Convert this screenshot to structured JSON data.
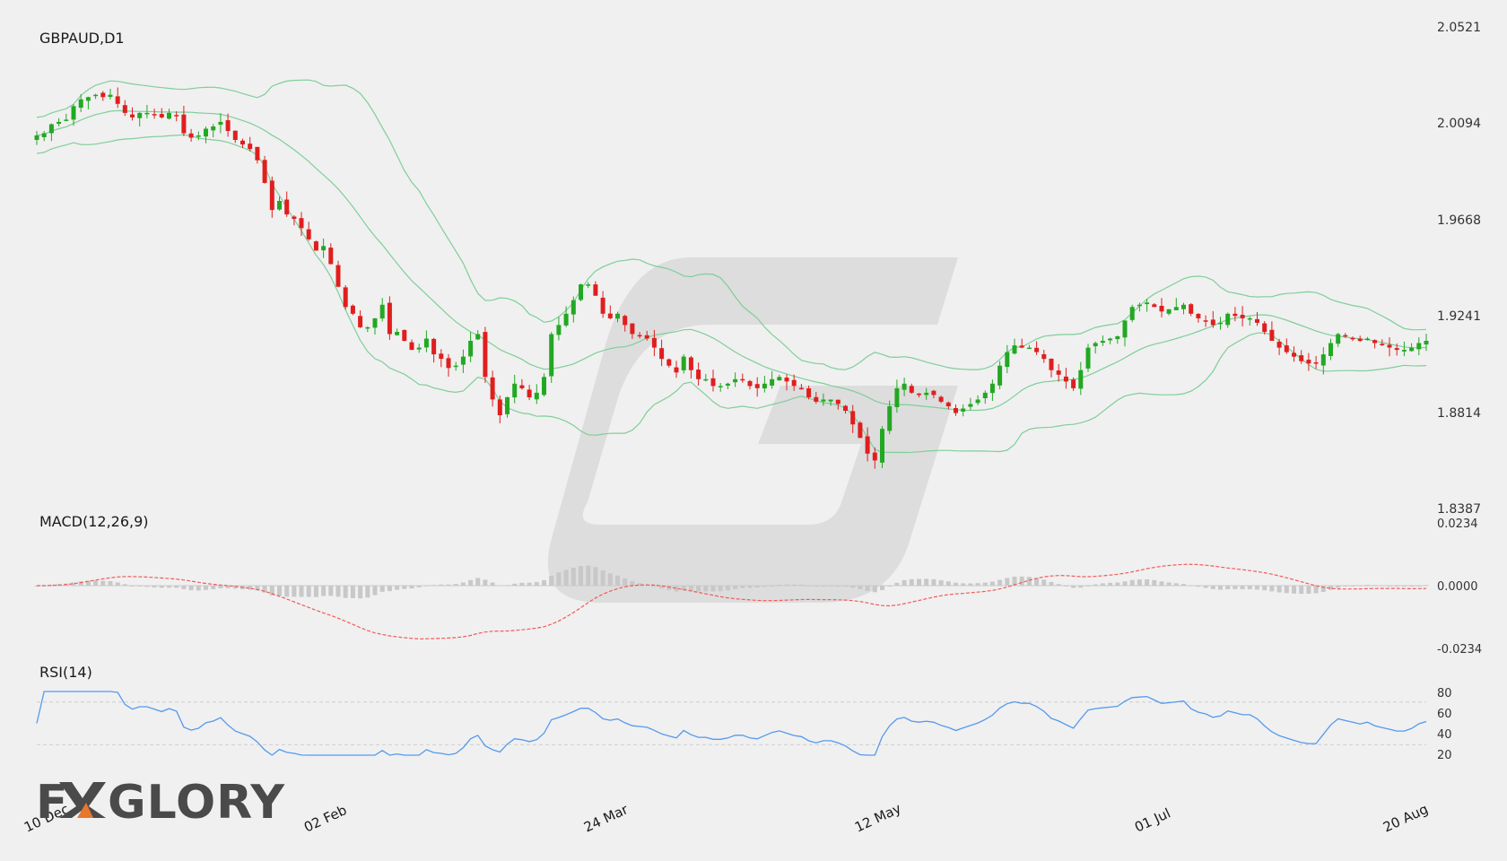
{
  "brand": {
    "logo_text_left": "F",
    "logo_text_right": "GLORY",
    "accent_color": "#e8772e",
    "text_color": "#4a4a4a"
  },
  "colors": {
    "up": "#22a822",
    "down": "#e01e1e",
    "band": "#7fce9a",
    "macd_hist": "#c8c8c8",
    "macd_signal": "#f25a5a",
    "rsi_line": "#5599ee",
    "grid": "#cccccc"
  },
  "chart_data": [
    {
      "type": "candlestick",
      "title": "GBPAUD,D1",
      "y_ticks": [
        "2.0521",
        "2.0094",
        "1.9668",
        "1.9241",
        "1.8814",
        "1.8387"
      ],
      "ylim": [
        1.8387,
        2.0521
      ],
      "x_ticks": [
        "10 Dec",
        "02 Feb",
        "24 Mar",
        "12 May",
        "01 Jul",
        "20 Aug"
      ],
      "close_series": [
        2.004,
        2.005,
        2.009,
        2.01,
        2.011,
        2.017,
        2.02,
        2.021,
        2.022,
        2.021,
        2.022,
        2.018,
        2.014,
        2.012,
        2.014,
        2.014,
        2.013,
        2.012,
        2.014,
        2.013,
        2.005,
        2.003,
        2.004,
        2.007,
        2.008,
        2.01,
        2.006,
        2.002,
        2.0,
        1.998,
        1.993,
        1.983,
        1.971,
        1.975,
        1.969,
        1.967,
        1.963,
        1.958,
        1.953,
        1.955,
        1.947,
        1.937,
        1.928,
        1.925,
        1.919,
        1.919,
        1.923,
        1.929,
        1.916,
        1.917,
        1.913,
        1.909,
        1.91,
        1.914,
        1.907,
        1.905,
        1.901,
        1.902,
        1.906,
        1.913,
        1.916,
        1.897,
        1.887,
        1.88,
        1.888,
        1.894,
        1.892,
        1.888,
        1.89,
        1.897,
        1.916,
        1.92,
        1.925,
        1.931,
        1.938,
        1.938,
        1.933,
        1.925,
        1.923,
        1.925,
        1.92,
        1.916,
        1.915,
        1.914,
        1.91,
        1.905,
        1.902,
        1.899,
        1.906,
        1.9,
        1.896,
        1.896,
        1.893,
        1.893,
        1.894,
        1.896,
        1.896,
        1.893,
        1.892,
        1.894,
        1.896,
        1.897,
        1.895,
        1.893,
        1.892,
        1.888,
        1.886,
        1.887,
        1.887,
        1.885,
        1.882,
        1.876,
        1.87,
        1.863,
        1.86,
        1.874,
        1.884,
        1.892,
        1.894,
        1.89,
        1.889,
        1.89,
        1.889,
        1.886,
        1.884,
        1.881,
        1.883,
        1.885,
        1.887,
        1.89,
        1.894,
        1.902,
        1.908,
        1.911,
        1.91,
        1.91,
        1.908,
        1.905,
        1.9,
        1.898,
        1.895,
        1.892,
        1.9,
        1.91,
        1.912,
        1.913,
        1.914,
        1.915,
        1.922,
        1.928,
        1.929,
        1.93,
        1.928,
        1.926,
        1.927,
        1.928,
        1.929,
        1.925,
        1.923,
        1.922,
        1.92,
        1.921,
        1.925,
        1.924,
        1.923,
        1.923,
        1.921,
        1.917,
        1.913,
        1.91,
        1.908,
        1.906,
        1.904,
        1.903,
        1.903,
        1.907,
        1.912,
        1.916,
        1.915,
        1.914,
        1.913,
        1.914,
        1.912,
        1.911,
        1.91,
        1.909,
        1.909,
        1.91,
        1.912,
        1.913
      ]
    },
    {
      "type": "bar+line",
      "title": "MACD(12,26,9)",
      "y_ticks": [
        "0.0234",
        "0.0000",
        "-0.0234"
      ],
      "ylim": [
        -0.0234,
        0.0234
      ]
    },
    {
      "type": "line",
      "title": "RSI(14)",
      "y_ticks": [
        "80",
        "60",
        "40",
        "20"
      ],
      "ylim": [
        20,
        80
      ],
      "guide_levels": [
        70,
        30
      ]
    }
  ]
}
